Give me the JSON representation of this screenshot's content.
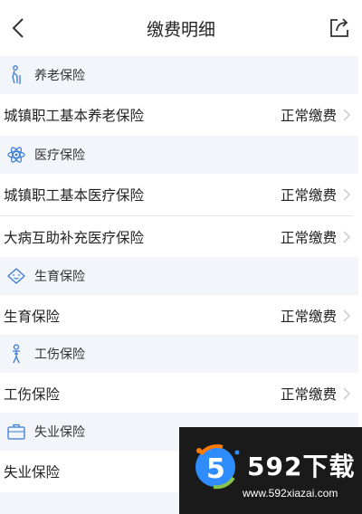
{
  "header": {
    "title": "缴费明细",
    "back_icon": "chevron-left-icon",
    "share_icon": "share-icon"
  },
  "sections": [
    {
      "label": "养老保险",
      "icon": "elderly-person-icon",
      "rows": [
        {
          "name": "城镇职工基本养老保险",
          "status": "正常缴费"
        }
      ]
    },
    {
      "label": "医疗保险",
      "icon": "atom-icon",
      "rows": [
        {
          "name": "城镇职工基本医疗保险",
          "status": "正常缴费"
        },
        {
          "name": "大病互助补充医疗保险",
          "status": "正常缴费"
        }
      ]
    },
    {
      "label": "生育保险",
      "icon": "baby-face-icon",
      "rows": [
        {
          "name": "生育保险",
          "status": "正常缴费"
        }
      ]
    },
    {
      "label": "工伤保险",
      "icon": "injured-person-icon",
      "rows": [
        {
          "name": "工伤保险",
          "status": "正常缴费"
        }
      ]
    },
    {
      "label": "失业保险",
      "icon": "briefcase-icon",
      "rows": [
        {
          "name": "失业保险",
          "status": ""
        }
      ]
    }
  ],
  "watermark": {
    "brand": "592下载",
    "url": "www.592xiazai.com"
  },
  "colors": {
    "accent": "#3a7bd5",
    "section_bg": "#f2f5f9",
    "chevron": "#c8c8c8"
  }
}
